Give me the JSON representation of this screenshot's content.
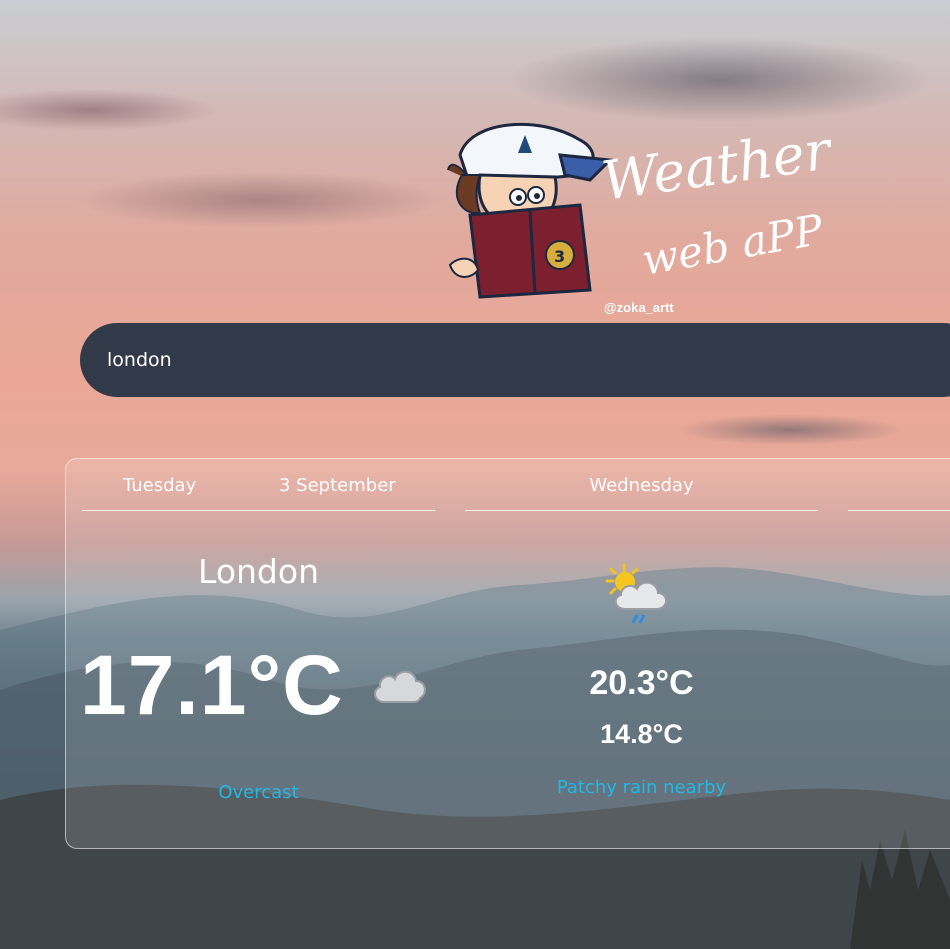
{
  "logo": {
    "title_line1": "Weather",
    "title_line2": "web aPP",
    "handle": "@zoka_artt",
    "mascot_badge": "3"
  },
  "search": {
    "value": "london"
  },
  "today": {
    "day": "Tuesday",
    "date": "3 September",
    "city": "London",
    "temperature": "17.1°C",
    "icon": "cloud-icon",
    "condition": "Overcast"
  },
  "tomorrow": {
    "day": "Wednesday",
    "icon": "sun-cloud-rain-icon",
    "max_temp": "20.3°C",
    "min_temp": "14.8°C",
    "condition": "Patchy rain nearby"
  },
  "colors": {
    "search_bg": "#323949",
    "condition_text": "#21b8e6",
    "text": "#ffffff"
  }
}
